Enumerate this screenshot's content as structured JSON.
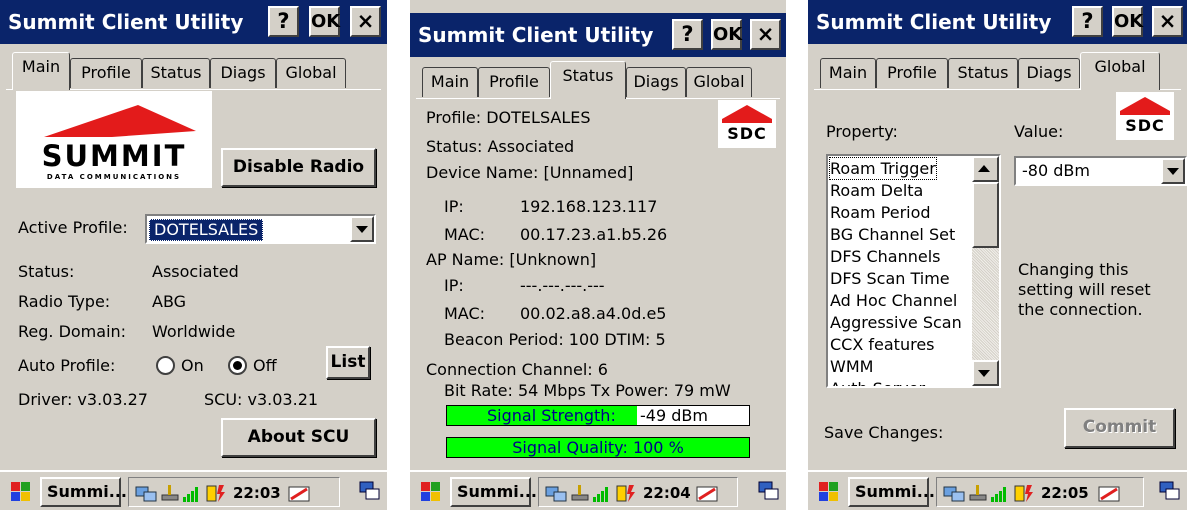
{
  "window": {
    "title": "Summit Client Utility",
    "help_label": "?",
    "ok_label": "OK",
    "close_label": "×"
  },
  "tabs": [
    "Main",
    "Profile",
    "Status",
    "Diags",
    "Global"
  ],
  "main": {
    "logo_word": "SUMMIT",
    "logo_sub": "DATA COMMUNICATIONS",
    "disable_radio_label": "Disable Radio",
    "active_profile_label": "Active Profile:",
    "active_profile_value": "DOTELSALES",
    "status_label": "Status:",
    "status_value": "Associated",
    "radio_type_label": "Radio Type:",
    "radio_type_value": "ABG",
    "reg_domain_label": "Reg. Domain:",
    "reg_domain_value": "Worldwide",
    "auto_profile_label": "Auto Profile:",
    "auto_on_label": "On",
    "auto_off_label": "Off",
    "auto_profile_selected": "Off",
    "list_label": "List",
    "driver_text": "Driver:  v3.03.27",
    "scu_text": "SCU: v3.03.21",
    "about_label": "About SCU",
    "clock": "22:03"
  },
  "status": {
    "sdc_logo": "SDC",
    "profile_line": "Profile: DOTELSALES",
    "status_line": "Status: Associated",
    "device_name_line": "Device Name: [Unnamed]",
    "ip_label": "IP:",
    "ip_value": "192.168.123.117",
    "mac_label": "MAC:",
    "mac_value": "00.17.23.a1.b5.26",
    "ap_name_line": "AP Name: [Unknown]",
    "ap_ip_label": "IP:",
    "ap_ip_value": "---.---.---.---",
    "ap_mac_label": "MAC:",
    "ap_mac_value": "00.02.a8.a4.0d.e5",
    "beacon_line": "Beacon Period: 100   DTIM: 5",
    "channel_line": "Connection Channel:   6",
    "bitrate_line": "Bit Rate: 54 Mbps  Tx Power:  79 mW",
    "signal_strength_label": "Signal Strength:",
    "signal_strength_value": "-49 dBm",
    "signal_strength_fill": 0.63,
    "signal_quality_label": "Signal Quality: 100 %",
    "signal_quality_fill": 1.0,
    "signal_color": "#00ff00",
    "clock": "22:04"
  },
  "global": {
    "sdc_logo": "SDC",
    "property_label": "Property:",
    "value_label": "Value:",
    "properties": [
      "Roam Trigger",
      "Roam Delta",
      "Roam Period",
      "BG Channel Set",
      "DFS Channels",
      "DFS Scan Time",
      "Ad Hoc Channel",
      "Aggressive Scan",
      "CCX features",
      "WMM",
      "Auth Server"
    ],
    "selected_property": "Roam Trigger",
    "value": "-80 dBm",
    "note": "Changing this setting will reset the connection.",
    "note_lines": [
      "Changing this",
      "setting will reset",
      "the connection."
    ],
    "save_changes_label": "Save Changes:",
    "commit_label": "Commit",
    "clock": "22:05"
  },
  "taskbar": {
    "task_label": "Summi..."
  },
  "colors": {
    "titlebar": "#0a246a",
    "face": "#d4d0c8",
    "logo_red": "#e31b1b"
  }
}
